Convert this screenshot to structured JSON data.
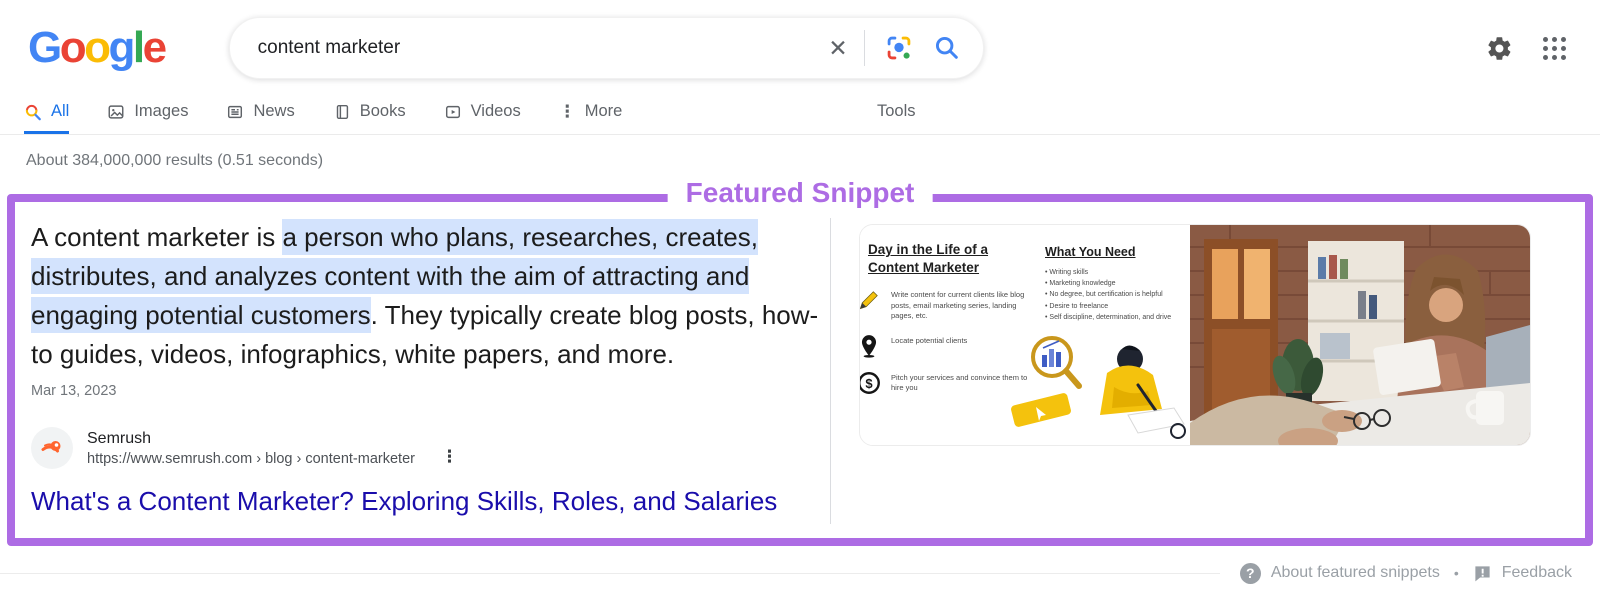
{
  "colors": {
    "accent": "#ad6ce4",
    "highlight": "#d3e3fd",
    "link_blue": "#1a0dab",
    "sel_blue": "#1a73e8",
    "text_dark": "#202124",
    "text_gray": "#70757a",
    "tab_gray": "#5f6368",
    "footer_gray": "#9aa0a6",
    "gblue": "#4285F4",
    "gred": "#EA4335",
    "gyellow": "#FBBC05",
    "ggreen": "#34A853"
  },
  "logo": {
    "letters": [
      "G",
      "o",
      "o",
      "g",
      "l",
      "e"
    ]
  },
  "search": {
    "value": "content marketer"
  },
  "glyphs": {
    "close": "✕",
    "more": "⋮",
    "kebab": "⋮"
  },
  "tabs": {
    "items": [
      {
        "label": "All"
      },
      {
        "label": "Images"
      },
      {
        "label": "News"
      },
      {
        "label": "Books"
      },
      {
        "label": "Videos"
      },
      {
        "label": "More"
      }
    ],
    "tools": "Tools"
  },
  "stats": {
    "text": "About 384,000,000 results (0.51 seconds)"
  },
  "snippet": {
    "label": "Featured Snippet",
    "text": {
      "prefix": "A content marketer is ",
      "highlight": "a person who plans, researches, creates, distributes, and analyzes content with the aim of attracting and engaging potential customers",
      "suffix": ". They typically create blog posts, how-to guides, videos, infographics, white papers, and more."
    },
    "date": "Mar 13, 2023",
    "source": {
      "name": "Semrush",
      "breadcrumb": "https://www.semrush.com › blog › content-marketer"
    },
    "title": "What's a Content Marketer? Exploring Skills, Roles, and Salaries",
    "infographic": {
      "title": "Day in the Life of a Content Marketer",
      "items": [
        {
          "text": "Write content for current clients like blog posts, email marketing series, landing pages, etc."
        },
        {
          "text": "Locate potential clients"
        },
        {
          "text": "Pitch your services and convince them to hire you"
        }
      ],
      "right_title": "What You Need",
      "right_items": [
        "Writing skills",
        "Marketing knowledge",
        "No degree, but certification is helpful",
        "Desire to freelance",
        "Self discipline, determination, and drive"
      ]
    }
  },
  "footer": {
    "help": "?",
    "about": "About featured snippets",
    "sep": "•",
    "feedback": "Feedback"
  }
}
